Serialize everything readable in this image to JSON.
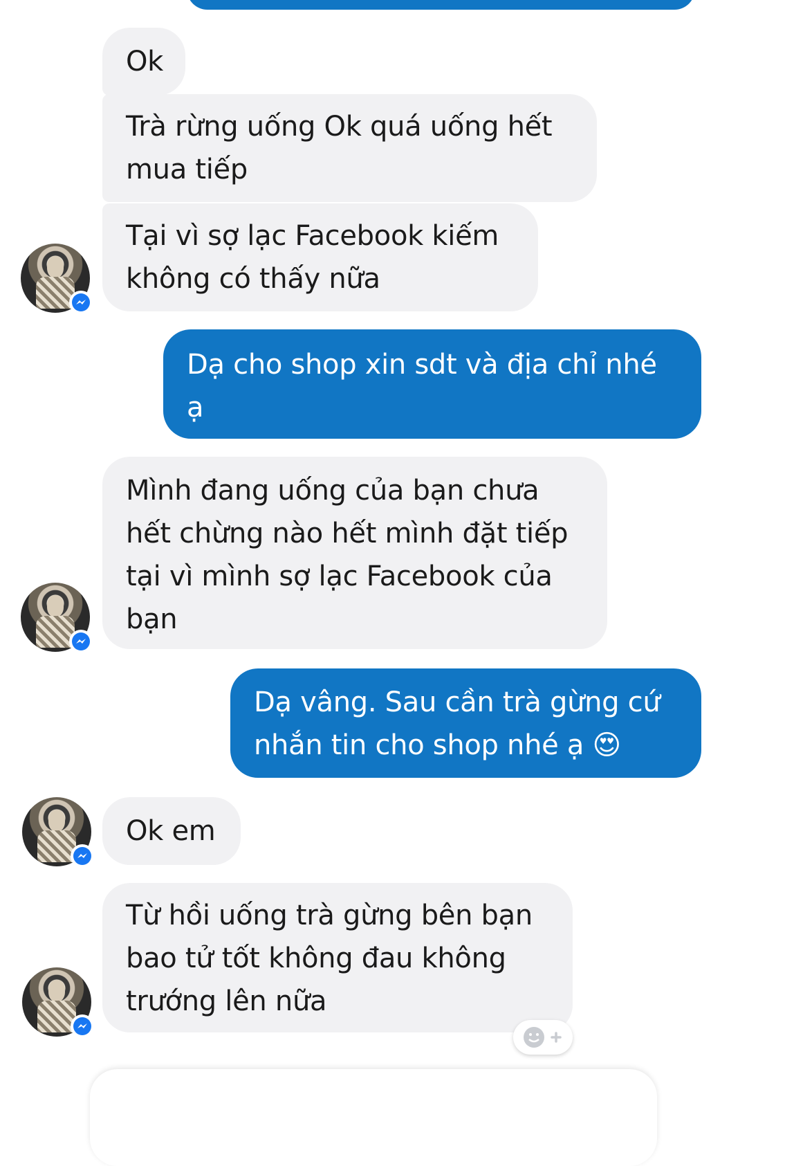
{
  "messages": {
    "m1": "Ok",
    "m2": "Trà rừng uống Ok quá uống hết\nmua tiếp",
    "m3": "Tại vì sợ lạc Facebook kiếm\nkhông có thấy nữa",
    "m4": "Dạ cho shop xin sdt và địa chỉ nhé\nạ",
    "m5": "Mình đang uống của bạn chưa\nhết chừng nào hết mình đặt tiếp\ntại vì mình sợ lạc Facebook của\nbạn",
    "m6": "Dạ vâng. Sau cần trà gừng cứ\nnhắn tin cho shop nhé ạ 😍",
    "m7": "Ok em",
    "m8": "Từ hồi uống trà gừng bên bạn\nbao tử tốt không đau không\ntrướng lên nữa"
  },
  "colors": {
    "outgoing": "#1176c4",
    "incoming": "#f1f1f3",
    "messenger_badge": "#1877f2"
  },
  "icons": {
    "badge": "messenger-icon",
    "reaction": "add-reaction-icon"
  }
}
